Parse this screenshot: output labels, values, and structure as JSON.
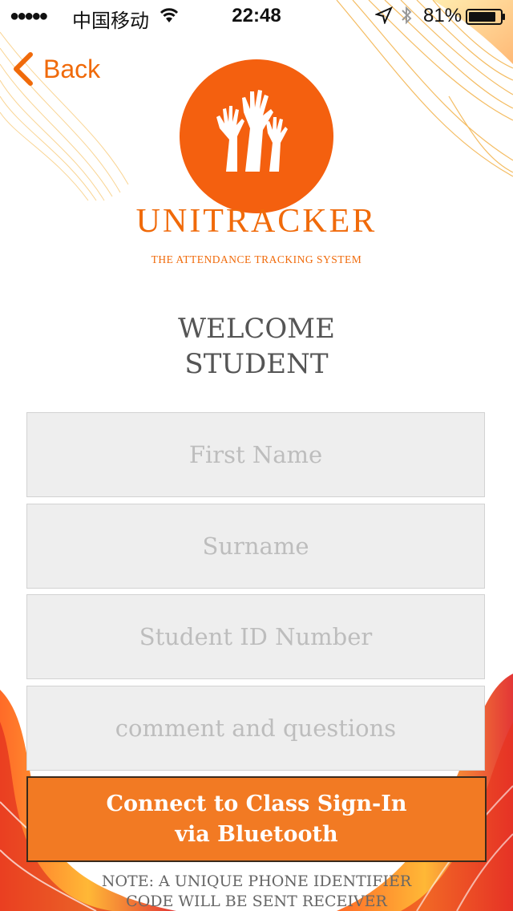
{
  "status_bar": {
    "signal": "●●●●●",
    "carrier": "中国移动",
    "time": "22:48",
    "battery_percent": "81%",
    "icons": [
      "wifi-icon",
      "location-arrow-icon",
      "bluetooth-icon",
      "battery-icon"
    ]
  },
  "nav": {
    "back_label": "Back",
    "back_icon": "chevron-left-icon"
  },
  "logo": {
    "title": "UNITRACKER",
    "subtitle": "THE ATTENDANCE TRACKING SYSTEM",
    "icon": "raised-hands-icon"
  },
  "heading": {
    "line1": "WELCOME",
    "line2": "STUDENT"
  },
  "form": {
    "first_name": {
      "placeholder": "First Name",
      "value": ""
    },
    "surname": {
      "placeholder": "Surname",
      "value": ""
    },
    "student_id": {
      "placeholder": "Student ID Number",
      "value": ""
    },
    "comments": {
      "placeholder": "comment and questions",
      "value": ""
    }
  },
  "connect_button": {
    "line1": "Connect to Class Sign-In",
    "line2": "via Bluetooth"
  },
  "note": {
    "line1": "NOTE: A UNIQUE PHONE IDENTIFIER",
    "line2": "CODE WILL BE SENT RECEIVER"
  },
  "colors": {
    "accent": "#f06a0a",
    "logo_circle": "#f4600f",
    "button": "#f27a23",
    "field_bg": "#eeeeee"
  }
}
